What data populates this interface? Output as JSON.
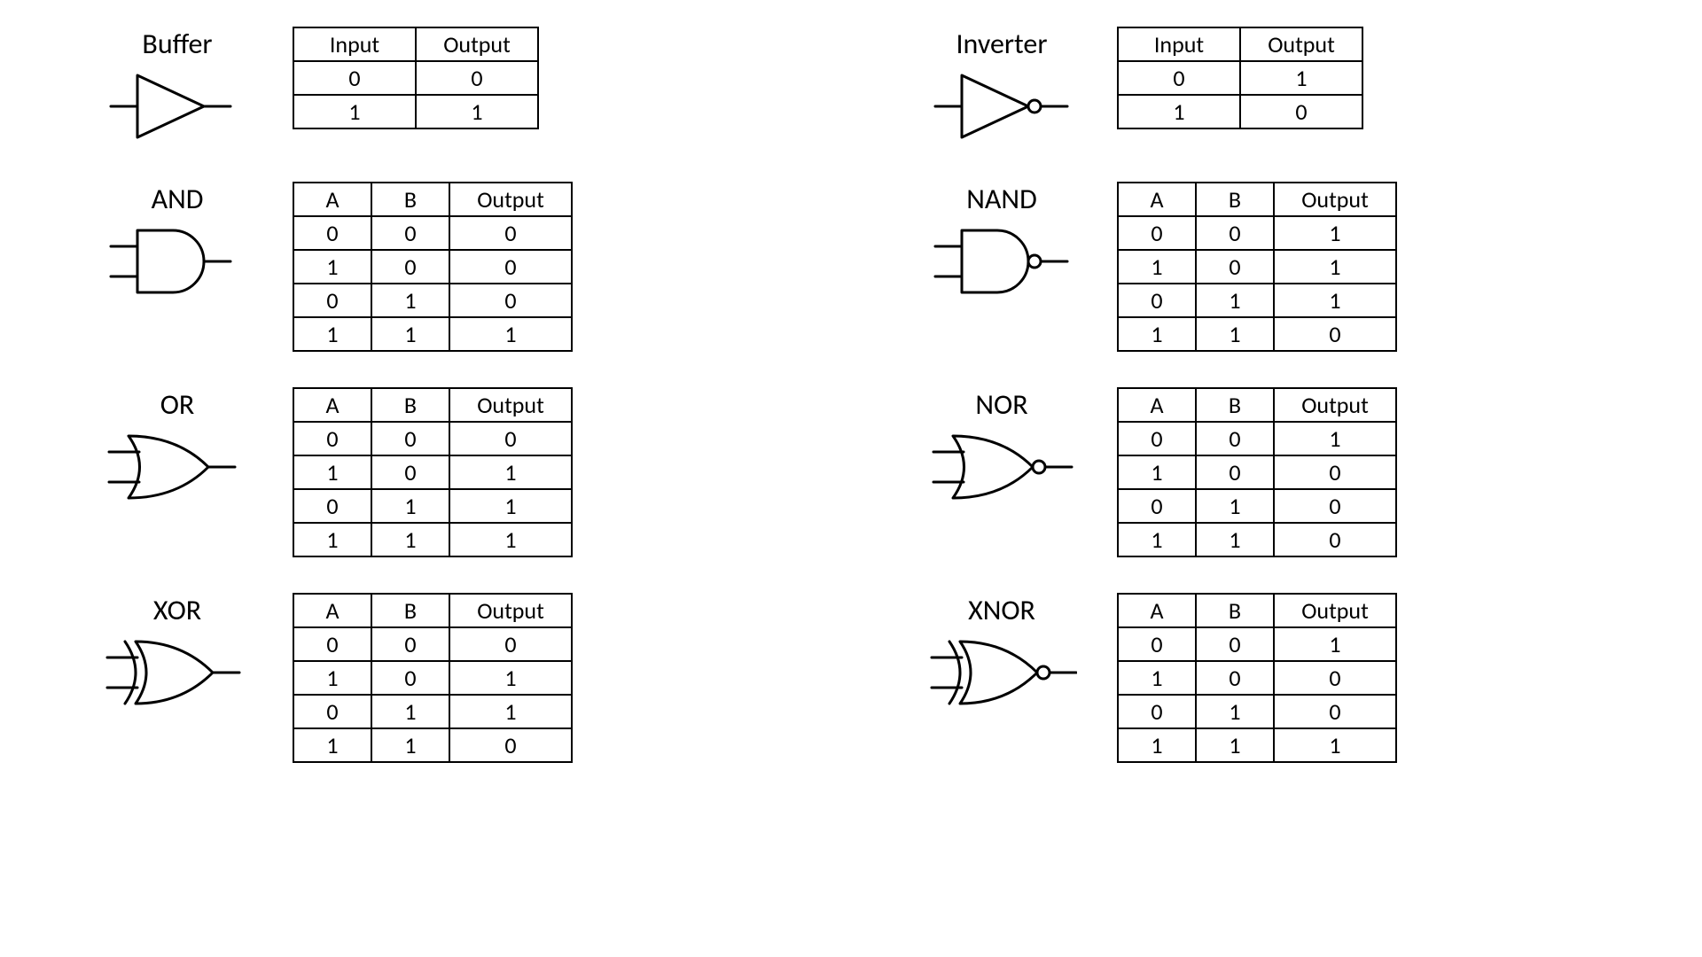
{
  "gates": [
    {
      "id": "buffer",
      "name": "Buffer",
      "shape": "buffer",
      "inputs": 1,
      "bubble": false,
      "headers": [
        "Input",
        "Output"
      ],
      "rows": [
        [
          "0",
          "0"
        ],
        [
          "1",
          "1"
        ]
      ]
    },
    {
      "id": "inverter",
      "name": "Inverter",
      "shape": "buffer",
      "inputs": 1,
      "bubble": true,
      "headers": [
        "Input",
        "Output"
      ],
      "rows": [
        [
          "0",
          "1"
        ],
        [
          "1",
          "0"
        ]
      ]
    },
    {
      "id": "and",
      "name": "AND",
      "shape": "and",
      "inputs": 2,
      "bubble": false,
      "headers": [
        "A",
        "B",
        "Output"
      ],
      "rows": [
        [
          "0",
          "0",
          "0"
        ],
        [
          "1",
          "0",
          "0"
        ],
        [
          "0",
          "1",
          "0"
        ],
        [
          "1",
          "1",
          "1"
        ]
      ]
    },
    {
      "id": "nand",
      "name": "NAND",
      "shape": "and",
      "inputs": 2,
      "bubble": true,
      "headers": [
        "A",
        "B",
        "Output"
      ],
      "rows": [
        [
          "0",
          "0",
          "1"
        ],
        [
          "1",
          "0",
          "1"
        ],
        [
          "0",
          "1",
          "1"
        ],
        [
          "1",
          "1",
          "0"
        ]
      ]
    },
    {
      "id": "or",
      "name": "OR",
      "shape": "or",
      "inputs": 2,
      "bubble": false,
      "headers": [
        "A",
        "B",
        "Output"
      ],
      "rows": [
        [
          "0",
          "0",
          "0"
        ],
        [
          "1",
          "0",
          "1"
        ],
        [
          "0",
          "1",
          "1"
        ],
        [
          "1",
          "1",
          "1"
        ]
      ]
    },
    {
      "id": "nor",
      "name": "NOR",
      "shape": "or",
      "inputs": 2,
      "bubble": true,
      "headers": [
        "A",
        "B",
        "Output"
      ],
      "rows": [
        [
          "0",
          "0",
          "1"
        ],
        [
          "1",
          "0",
          "0"
        ],
        [
          "0",
          "1",
          "0"
        ],
        [
          "1",
          "1",
          "0"
        ]
      ]
    },
    {
      "id": "xor",
      "name": "XOR",
      "shape": "xor",
      "inputs": 2,
      "bubble": false,
      "headers": [
        "A",
        "B",
        "Output"
      ],
      "rows": [
        [
          "0",
          "0",
          "0"
        ],
        [
          "1",
          "0",
          "1"
        ],
        [
          "0",
          "1",
          "1"
        ],
        [
          "1",
          "1",
          "0"
        ]
      ]
    },
    {
      "id": "xnor",
      "name": "XNOR",
      "shape": "xor",
      "inputs": 2,
      "bubble": true,
      "headers": [
        "A",
        "B",
        "Output"
      ],
      "rows": [
        [
          "0",
          "0",
          "1"
        ],
        [
          "1",
          "0",
          "0"
        ],
        [
          "0",
          "1",
          "0"
        ],
        [
          "1",
          "1",
          "1"
        ]
      ]
    }
  ]
}
